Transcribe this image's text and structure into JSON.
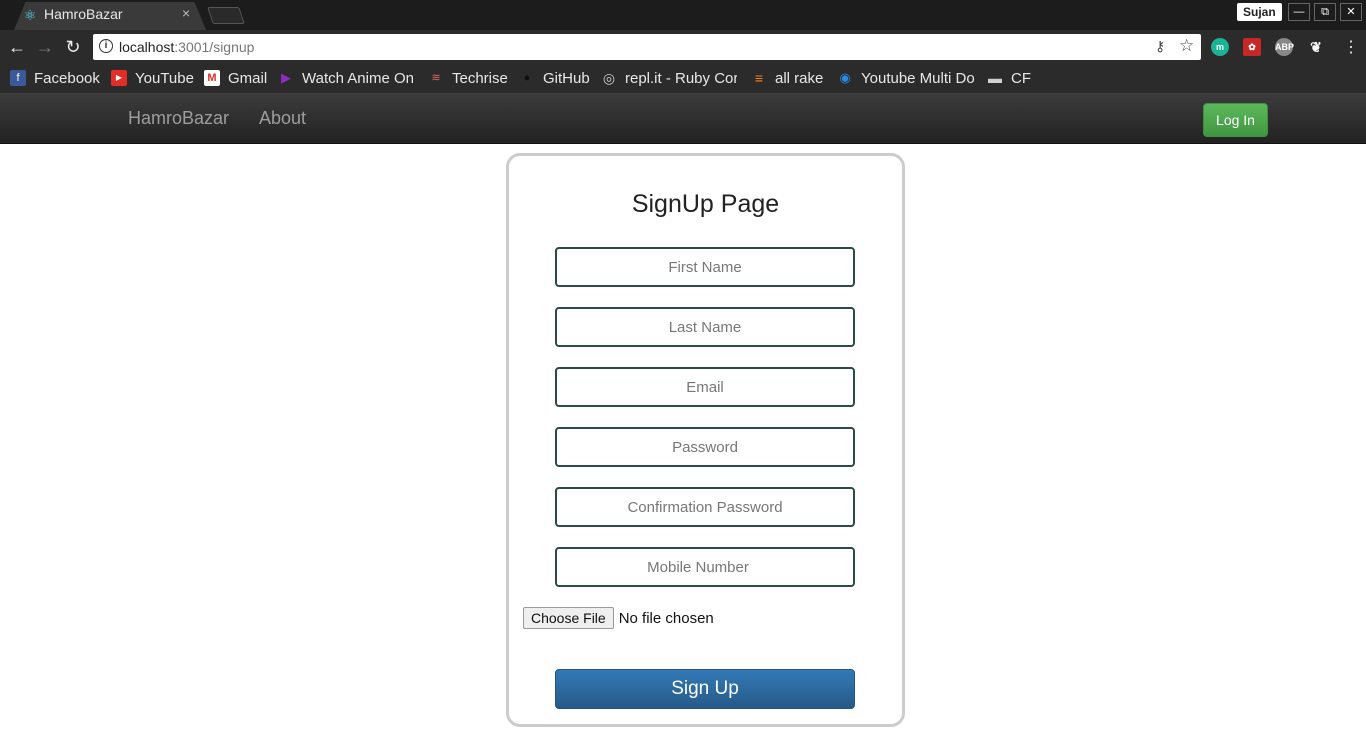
{
  "browser": {
    "tab_title": "HamroBazar",
    "tab_close": "×",
    "profile_name": "Sujan",
    "window_controls": {
      "minimize": "—",
      "restore": "⧉",
      "close": "✕"
    },
    "url_host": "localhost",
    "url_path": ":3001/signup",
    "bookmarks": [
      {
        "label": "Facebook",
        "icon": "facebook-icon",
        "color": "#3b5998",
        "glyph": "f"
      },
      {
        "label": "YouTube",
        "icon": "youtube-icon",
        "color": "#e52d27",
        "glyph": "▶"
      },
      {
        "label": "Gmail",
        "icon": "gmail-icon",
        "color": "#d93025",
        "glyph": "M"
      },
      {
        "label": "Watch Anime Onl",
        "icon": "play-icon",
        "color": "#8e2bbf",
        "glyph": "▶"
      },
      {
        "label": "Techrise",
        "icon": "techrise-icon",
        "color": "#b03030",
        "glyph": "≋"
      },
      {
        "label": "GitHub",
        "icon": "github-icon",
        "color": "#222222",
        "glyph": "●"
      },
      {
        "label": "repl.it - Ruby Cor",
        "icon": "replit-icon",
        "color": "#555555",
        "glyph": "◎"
      },
      {
        "label": "all rake",
        "icon": "stackoverflow-icon",
        "color": "#f48024",
        "glyph": "≡"
      },
      {
        "label": "Youtube Multi Do",
        "icon": "youtube-multi-icon",
        "color": "#1a6fb5",
        "glyph": "◉"
      },
      {
        "label": "CF",
        "icon": "folder-icon",
        "color": "#cfcfcf",
        "glyph": "▬"
      }
    ]
  },
  "navbar": {
    "brand": "HamroBazar",
    "about": "About",
    "login": "Log In"
  },
  "form": {
    "title": "SignUp Page",
    "first_name_placeholder": "First Name",
    "last_name_placeholder": "Last Name",
    "email_placeholder": "Email",
    "password_placeholder": "Password",
    "confirm_password_placeholder": "Confirmation Password",
    "mobile_placeholder": "Mobile Number",
    "choose_file": "Choose File",
    "file_status": "No file chosen",
    "submit": "Sign Up"
  }
}
